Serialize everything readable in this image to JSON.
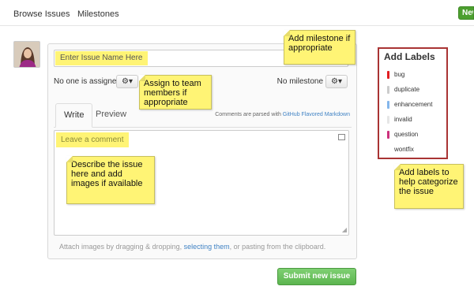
{
  "nav": {
    "browse_issues": "Browse Issues",
    "milestones": "Milestones",
    "new_button": "New"
  },
  "issue": {
    "title_placeholder": "Enter Issue Name Here",
    "assignee_text": "No one is assigned",
    "milestone_text": "No milestone",
    "tabs": [
      {
        "label": "Write",
        "active": true
      },
      {
        "label": "Preview",
        "active": false
      }
    ],
    "markdown_note_prefix": "Comments are parsed with",
    "markdown_link": "GitHub Flavored Markdown",
    "comment_placeholder": "Leave a comment",
    "attach_prefix": "Attach images by dragging & dropping,",
    "attach_link": "selecting them",
    "attach_suffix": ", or pasting from the clipboard.",
    "submit_label": "Submit new issue"
  },
  "labels": {
    "title": "Add Labels",
    "items": [
      {
        "name": "bug",
        "color": "#e11d21"
      },
      {
        "name": "duplicate",
        "color": "#cccccc"
      },
      {
        "name": "enhancement",
        "color": "#84b6eb"
      },
      {
        "name": "invalid",
        "color": "#e6e6e6"
      },
      {
        "name": "question",
        "color": "#cc317c"
      },
      {
        "name": "wontfix",
        "color": "#ffffff"
      }
    ]
  },
  "notes": {
    "milestone": "Add milestone if appropriate",
    "assign": "Assign to team members if appropriate",
    "describe": "Describe the issue here and add images if available",
    "labels": "Add labels to help categorize the issue"
  },
  "colors": {
    "accent_link": "#4183c4",
    "submit_green": "#5cb54f",
    "sticky_yellow": "#fff475",
    "labels_border": "#a93434"
  }
}
